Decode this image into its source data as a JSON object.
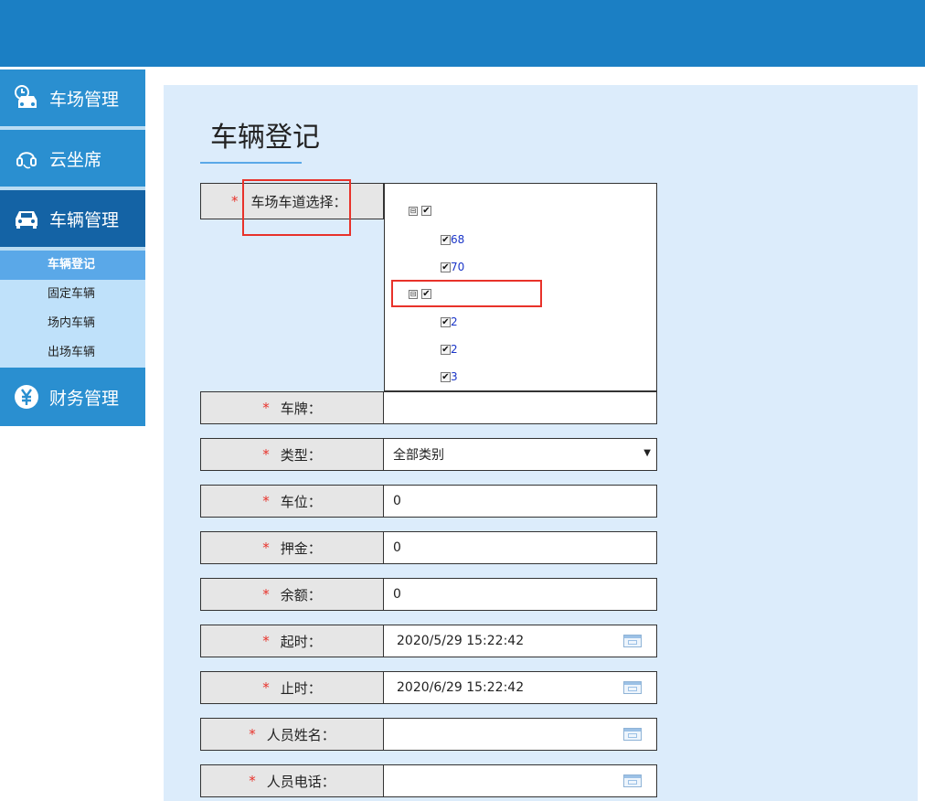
{
  "sidebar": {
    "menus": [
      {
        "label": "车场管理",
        "icon": "parking-car-clock-icon"
      },
      {
        "label": "云坐席",
        "icon": "headset-icon"
      },
      {
        "label": "车辆管理",
        "icon": "car-icon"
      },
      {
        "label": "财务管理",
        "icon": "yuan-icon"
      }
    ],
    "submenu": [
      "车辆登记",
      "固定车辆",
      "场内车辆",
      "出场车辆"
    ]
  },
  "page": {
    "title": "车辆登记"
  },
  "form": {
    "lane_label": "车场车道选择：",
    "required_mark": "*",
    "tree": {
      "groups": [
        {
          "label": "",
          "children": [
            "68",
            "70"
          ]
        },
        {
          "label": "",
          "children": [
            "2",
            "2",
            "3"
          ]
        }
      ],
      "toggle_symbol": "⊟",
      "check_symbol": "✔"
    },
    "fields": [
      {
        "label": "车牌：",
        "value": ""
      },
      {
        "label": "类型：",
        "value": "全部类别"
      },
      {
        "label": "车位：",
        "value": "0"
      },
      {
        "label": "押金：",
        "value": "0"
      },
      {
        "label": "余额：",
        "value": "0"
      },
      {
        "label": "起时：",
        "value": "2020/5/29 15:22:42"
      },
      {
        "label": "止时：",
        "value": "2020/6/29 15:22:42"
      },
      {
        "label": "人员姓名：",
        "value": ""
      },
      {
        "label": "人员电话：",
        "value": ""
      }
    ],
    "select_arrow": "▼"
  },
  "colors": {
    "topbar": "#1b7fc4",
    "menu": "#2a8fd0",
    "menu_active": "#1463a5",
    "submenu_active": "#5aa8e8",
    "required": "#e8322a",
    "panel": "#dcecfb"
  }
}
